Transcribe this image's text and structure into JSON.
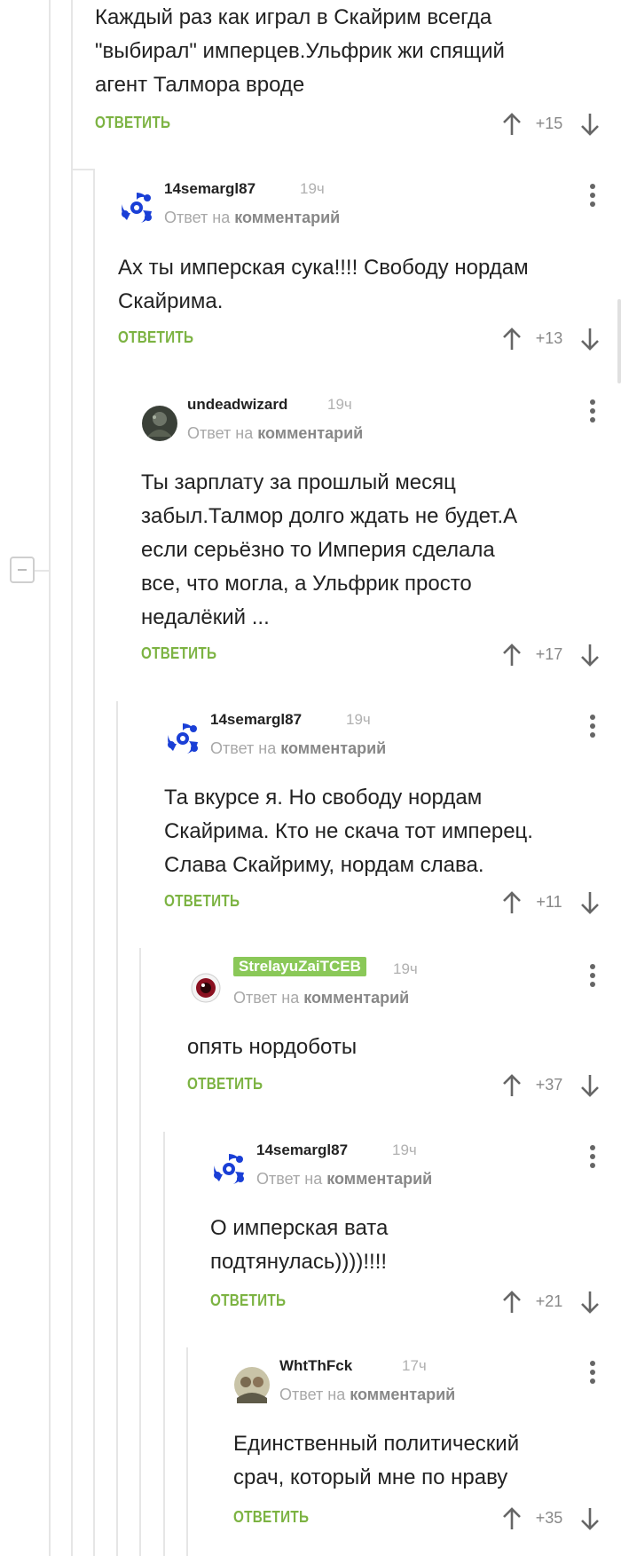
{
  "first_comment": {
    "lines": [
      "Каждый раз как играл в Скайрим всегда",
      "\"выбирал\" имперцев.Ульфрик жи спящий",
      "агент Талмора вроде"
    ],
    "answer_label": "ОТВЕТИТЬ",
    "rating": "+15"
  },
  "reply_prefix": "Ответ на",
  "reply_target": "комментарий",
  "comments": [
    {
      "user": "14semargl87",
      "time": "19ч",
      "avatar": "swirl-avatar",
      "lines": [
        "Ах ты имперская сука!!!! Свободу нордам",
        "Скайрима."
      ],
      "answer_label": "ОТВЕТИТЬ",
      "rating": "+13"
    },
    {
      "user": "undeadwizard",
      "time": "19ч",
      "avatar": "dark-avatar",
      "lines": [
        "Ты зарплату за прошлый месяц",
        "забыл.Талмор долго ждать не будет.А",
        "если серьёзно то Империя сделала",
        "все, что могла, а Ульфрик просто",
        "недалёкий ..."
      ],
      "answer_label": "ОТВЕТИТЬ",
      "rating": "+17"
    },
    {
      "user": "14semargl87",
      "time": "19ч",
      "avatar": "swirl-avatar",
      "lines": [
        "Та вкурсе я. Но свободу нордам",
        "Скайрима. Кто не скача тот имперец.",
        "Слава Скайриму, нордам слава."
      ],
      "answer_label": "ОТВЕТИТЬ",
      "rating": "+11"
    },
    {
      "user": "StrelayuZaiTCEB",
      "time": "19ч",
      "avatar": "eye-avatar",
      "lines": [
        "опять нордоботы"
      ],
      "answer_label": "ОТВЕТИТЬ",
      "rating": "+37"
    },
    {
      "user": "14semargl87",
      "time": "19ч",
      "avatar": "swirl-avatar",
      "lines": [
        "О имперская вата",
        "подтянулась))))!!!!"
      ],
      "answer_label": "ОТВЕТИТЬ",
      "rating": "+21"
    },
    {
      "user": "WhtThFck",
      "time": "17ч",
      "avatar": "photo-avatar",
      "lines": [
        "Единственный политический",
        "срач, который мне по нраву"
      ],
      "answer_label": "ОТВЕТИТЬ",
      "rating": "+35"
    }
  ],
  "colors": {
    "accent": "#7cb342",
    "badge": "#8ac858",
    "swirl": "#1a3fd6"
  }
}
